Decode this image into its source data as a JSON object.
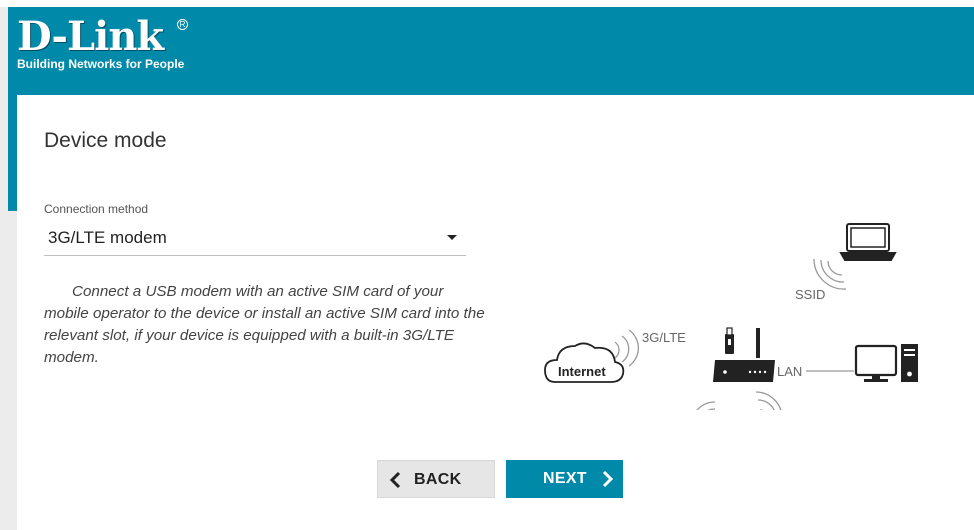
{
  "brand": {
    "logo_text": "D-Link",
    "tagline": "Building Networks for People",
    "primary_color": "#0089a8"
  },
  "page": {
    "title": "Device mode"
  },
  "connection": {
    "label": "Connection method",
    "selected": "3G/LTE modem"
  },
  "description": "Connect a USB modem with an active SIM card of your mobile operator to the device or install an active SIM card into the relevant slot, if your device is equipped with a built-in 3G/LTE modem.",
  "diagram": {
    "internet_label": "Internet",
    "lte_label": "3G/LTE",
    "ssid_label": "SSID",
    "lan_label": "LAN",
    "icons": [
      "cloud-icon",
      "router-icon",
      "usb-modem-icon",
      "laptop-icon",
      "desktop-pc-icon"
    ]
  },
  "buttons": {
    "back_label": "BACK",
    "next_label": "NEXT"
  }
}
